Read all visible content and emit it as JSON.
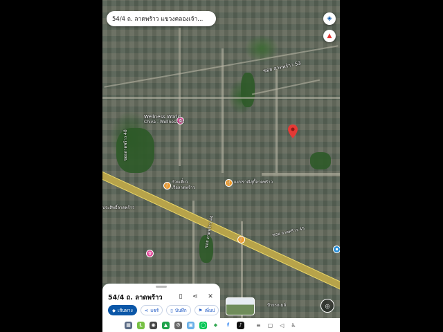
{
  "search": {
    "query": "54/4 ถ. ลาดพร้าว แขวงคลองเจ้า..."
  },
  "map_labels": {
    "soi_lat_phrao_53": "ซอย ลาดพร้าว 53",
    "wellness_world": "Wellness World",
    "wellness_sub": "Chiva - Wellness Fit",
    "food_place_left": "ก๋วยเตี๋ยว",
    "food_place_left_sub": "เรือลาดพร้าว",
    "food_place_mid": "แม่ปราณีสุกี้ลาดพร้าว",
    "left_road": "ซอยลาดพร้าว 48",
    "soi_lat_phrao_44": "ซอย ลาดพร้าว 44",
    "soi_lat_phrao_45": "ซอย ลาดพร้าว 45",
    "left_building": "ประสิทธิ์ลาดพร้าว",
    "bottom_right": "ป้ายรถเมล์"
  },
  "sheet": {
    "title": "54/4 ถ. ลาดพร้าว",
    "actions": {
      "directions": "เส้นทาง",
      "share": "แชร์",
      "save": "บันทึก",
      "label": "เพิ่มป"
    }
  },
  "navbar": {
    "apps": [
      "messages-app",
      "line-app",
      "camera-app",
      "shield-app",
      "settings-app",
      "gallery-app",
      "line-chat-app",
      "maps-app",
      "facebook-app",
      "tiktok-app"
    ]
  },
  "colors": {
    "pin": "#e53935",
    "accent": "#0b57a8",
    "road": "#e8d66a"
  }
}
